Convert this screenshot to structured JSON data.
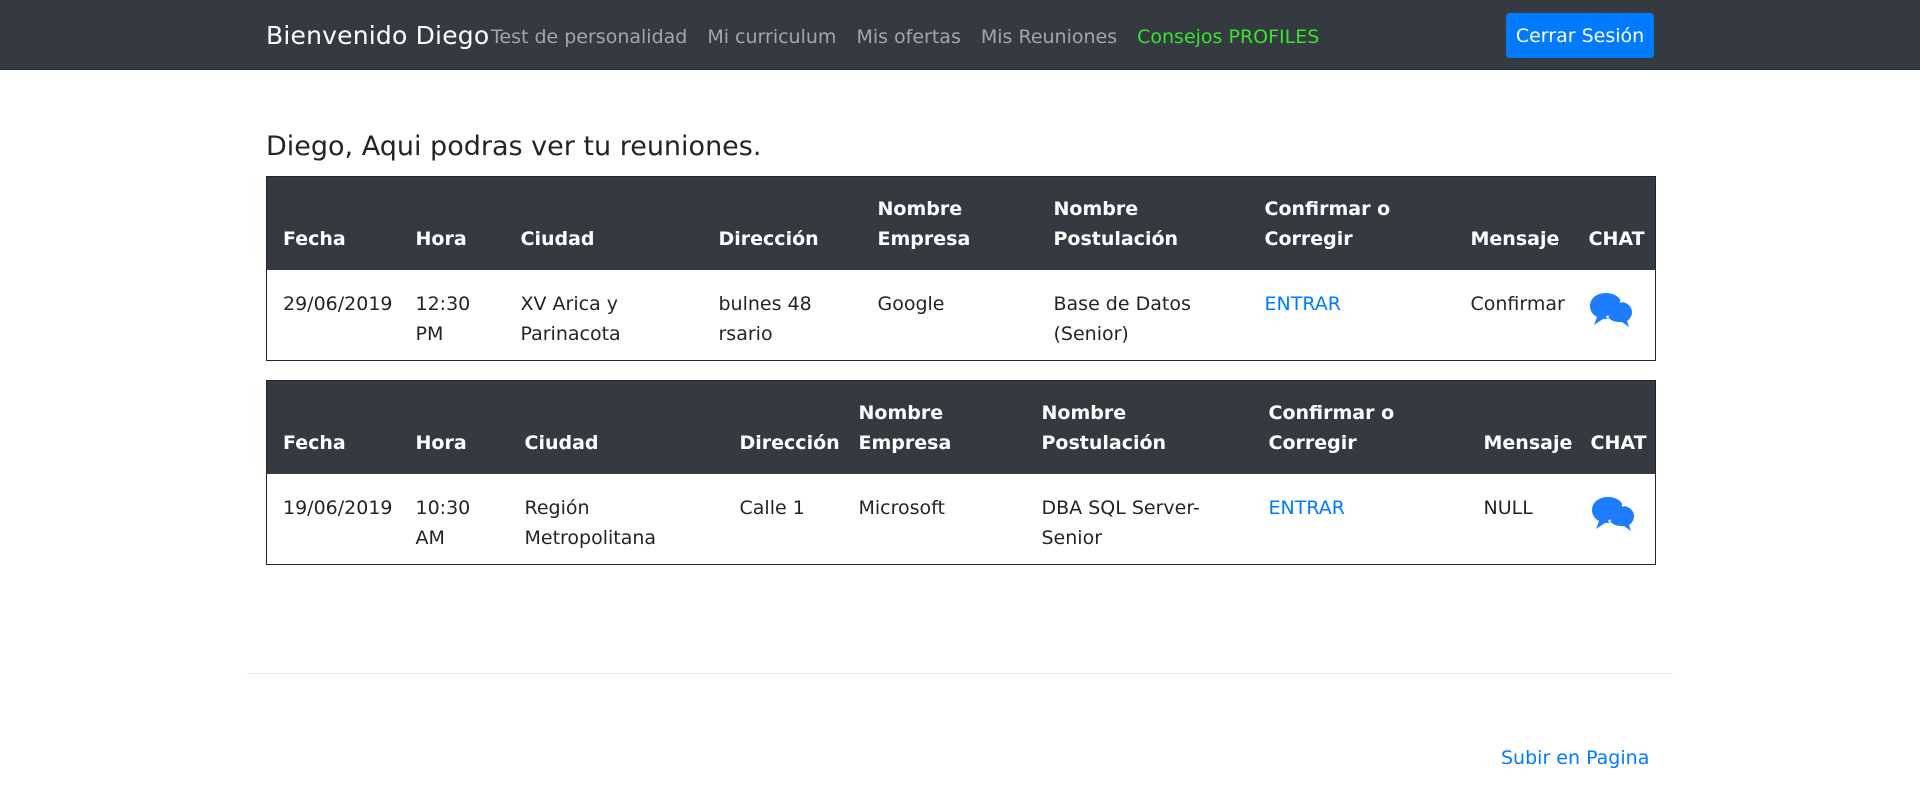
{
  "navbar": {
    "brand": "Bienvenido Diego",
    "links": [
      {
        "label": "Test de personalidad"
      },
      {
        "label": "Mi curriculum"
      },
      {
        "label": "Mis ofertas"
      },
      {
        "label": "Mis Reuniones"
      },
      {
        "label": "Consejos PROFILES",
        "color": "#39e22e"
      }
    ],
    "logout_label": "Cerrar Sesión"
  },
  "main": {
    "title": "Diego, Aqui podras ver tu reuniones.",
    "meetings": [
      {
        "headers": [
          "Fecha",
          "Hora",
          "Ciudad",
          "Dirección",
          "Nombre Empresa",
          "Nombre Postulación",
          "Confirmar o Corregir",
          "Mensaje",
          "CHAT"
        ],
        "fecha": "29/06/2019",
        "hora": "12:30 PM",
        "ciudad": "XV Arica y Parinacota",
        "direccion": "bulnes 48 rsario",
        "empresa": "Google",
        "postulacion": "Base de Datos (Senior)",
        "confirmar": "ENTRAR",
        "mensaje": "Confirmar",
        "chat_icon": "chat-bubbles-icon"
      },
      {
        "headers": [
          "Fecha",
          "Hora",
          "Ciudad",
          "Dirección",
          "Nombre Empresa",
          "Nombre Postulación",
          "Confirmar o Corregir",
          "Mensaje",
          "CHAT"
        ],
        "fecha": "19/06/2019",
        "hora": "10:30 AM",
        "ciudad": "Región Metropolitana",
        "direccion": "Calle 1",
        "empresa": "Microsoft",
        "postulacion": "DBA SQL Server-Senior",
        "confirmar": "ENTRAR",
        "mensaje": "NULL",
        "chat_icon": "chat-bubbles-icon"
      }
    ]
  },
  "footer": {
    "scroll_top_label": "Subir en Pagina"
  },
  "colors": {
    "navbar_bg": "#343a40",
    "primary": "#007bff",
    "accent_link": "#39e22e"
  }
}
